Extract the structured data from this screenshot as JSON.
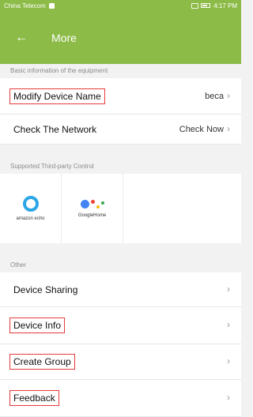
{
  "status_bar": {
    "carrier": "China Telecom",
    "time": "4:17 PM"
  },
  "app_bar": {
    "back_icon": "back-arrow-icon",
    "title": "More"
  },
  "sections": {
    "basic": {
      "header": "Basic information of the equipment",
      "rows": [
        {
          "label": "Modify Device Name",
          "value": "beca"
        },
        {
          "label": "Check The Network",
          "value": "Check Now"
        }
      ]
    },
    "third_party": {
      "header": "Supported Third-party Control",
      "cards": [
        {
          "name": "amazon echo"
        },
        {
          "name": "GoogleHome"
        }
      ]
    },
    "other": {
      "header": "Other",
      "rows": [
        {
          "label": "Device Sharing"
        },
        {
          "label": "Device Info"
        },
        {
          "label": "Create Group"
        },
        {
          "label": "Feedback"
        }
      ]
    }
  },
  "colors": {
    "accent": "#8cbb47",
    "highlight_box": "#e63a3a"
  }
}
